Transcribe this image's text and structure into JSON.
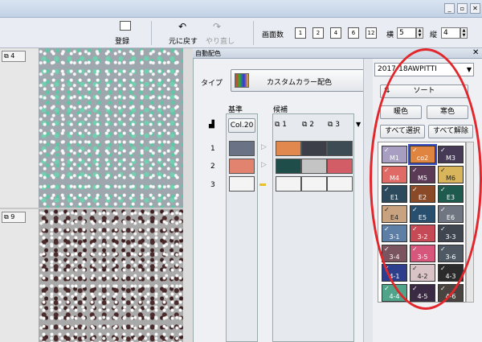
{
  "toolbar": {
    "register": "登録",
    "undo": "元に戻す",
    "redo": "やり直し",
    "screen_count_label": "画面数",
    "panes": [
      "1",
      "2",
      "4",
      "6",
      "12"
    ],
    "horizontal_label": "横",
    "horizontal_value": "5",
    "vertical_label": "縦",
    "vertical_value": "4"
  },
  "left": {
    "row1_tag": "4",
    "row2_tag": "9"
  },
  "panel": {
    "title": "自動配色",
    "type_label": "タイプ",
    "type_value": "カスタムカラー配色",
    "kijun_label": "基準",
    "kouho_label": "候補",
    "col_button": "Col.20",
    "candidates": [
      "1",
      "2",
      "3"
    ],
    "row_numbers": [
      "1",
      "2",
      "3"
    ],
    "base_colors": [
      "#6a7286",
      "#e1836f",
      "#f4f4f4"
    ],
    "candidate_rows": [
      [
        "#e1884e",
        "#3c3e48",
        "#3d4b55"
      ],
      [
        "#1f4d4a",
        "#c4c4c4",
        "#d25d66"
      ],
      [
        "#f4f4f4",
        "#f4f4f4",
        "#f4f4f4"
      ]
    ]
  },
  "palette": {
    "dropdown_value": "2017-18AWPITTI",
    "sort_button": "ソート",
    "warm_button": "暖色",
    "cool_button": "寒色",
    "select_all": "すべて選択",
    "deselect_all": "すべて解除",
    "colors": [
      {
        "label": "M1",
        "color": "#a79ec1"
      },
      {
        "label": "co2",
        "color": "#e0853f"
      },
      {
        "label": "M3",
        "color": "#463a57"
      },
      {
        "label": "M4",
        "color": "#e06b66"
      },
      {
        "label": "M5",
        "color": "#5a3a55"
      },
      {
        "label": "M6",
        "color": "#d8b45a"
      },
      {
        "label": "E1",
        "color": "#2c4a5c"
      },
      {
        "label": "E2",
        "color": "#8a4a28"
      },
      {
        "label": "E3",
        "color": "#1f5a4e"
      },
      {
        "label": "E4",
        "color": "#c9a37f"
      },
      {
        "label": "E5",
        "color": "#284f6e"
      },
      {
        "label": "E6",
        "color": "#6f7681"
      },
      {
        "label": "3-1",
        "color": "#5d7fa6"
      },
      {
        "label": "3-2",
        "color": "#c64a55"
      },
      {
        "label": "3-3",
        "color": "#3f4650"
      },
      {
        "label": "3-4",
        "color": "#7a5560"
      },
      {
        "label": "3-5",
        "color": "#d6577b"
      },
      {
        "label": "3-6",
        "color": "#4f5964"
      },
      {
        "label": "4-1",
        "color": "#2d3f8c"
      },
      {
        "label": "4-2",
        "color": "#d9c3c7"
      },
      {
        "label": "4-3",
        "color": "#2b2b2b"
      },
      {
        "label": "4-4",
        "color": "#4fa48a"
      },
      {
        "label": "4-5",
        "color": "#3a2a44"
      },
      {
        "label": "4-6",
        "color": "#4a4440"
      }
    ]
  },
  "accent": "#e2262b"
}
